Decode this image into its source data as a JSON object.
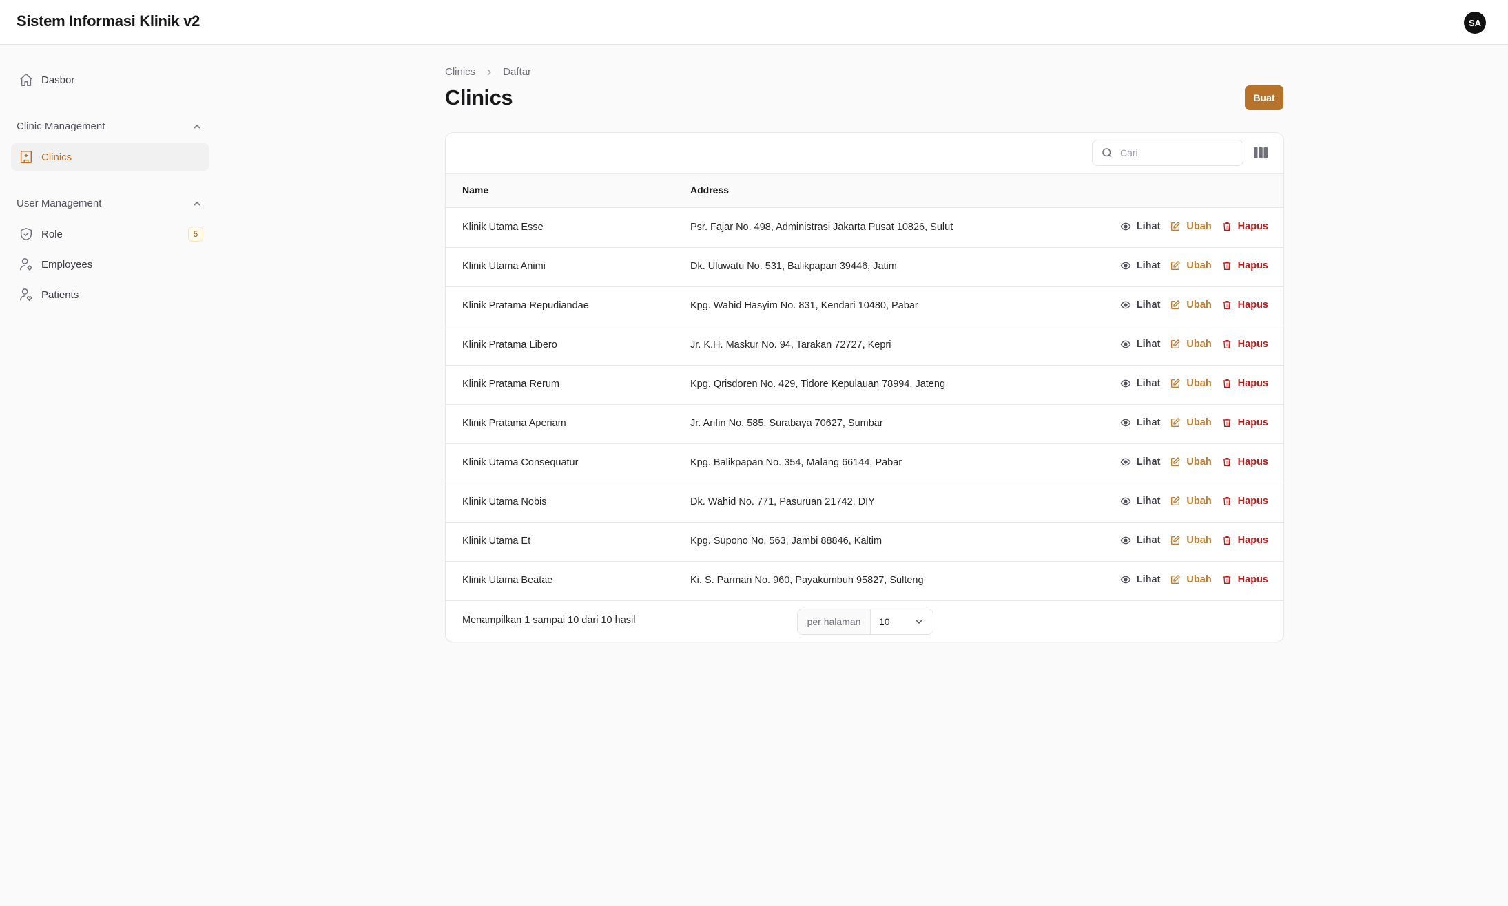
{
  "app": {
    "title": "Sistem Informasi Klinik v2",
    "avatar_initials": "SA"
  },
  "sidebar": {
    "dashboard_label": "Dasbor",
    "groups": [
      {
        "label": "Clinic Management",
        "items": [
          {
            "label": "Clinics",
            "active": true
          }
        ]
      },
      {
        "label": "User Management",
        "items": [
          {
            "label": "Role",
            "badge": "5"
          },
          {
            "label": "Employees"
          },
          {
            "label": "Patients"
          }
        ]
      }
    ]
  },
  "breadcrumb": [
    "Clinics",
    "Daftar"
  ],
  "page": {
    "title": "Clinics",
    "create_label": "Buat"
  },
  "table": {
    "search_placeholder": "Cari",
    "columns": [
      "Name",
      "Address"
    ],
    "action_labels": {
      "view": "Lihat",
      "edit": "Ubah",
      "delete": "Hapus"
    },
    "rows": [
      {
        "name": "Klinik Utama Esse",
        "address": "Psr. Fajar No. 498, Administrasi Jakarta Pusat 10826, Sulut"
      },
      {
        "name": "Klinik Utama Animi",
        "address": "Dk. Uluwatu No. 531, Balikpapan 39446, Jatim"
      },
      {
        "name": "Klinik Pratama Repudiandae",
        "address": "Kpg. Wahid Hasyim No. 831, Kendari 10480, Pabar"
      },
      {
        "name": "Klinik Pratama Libero",
        "address": "Jr. K.H. Maskur No. 94, Tarakan 72727, Kepri"
      },
      {
        "name": "Klinik Pratama Rerum",
        "address": "Kpg. Qrisdoren No. 429, Tidore Kepulauan 78994, Jateng"
      },
      {
        "name": "Klinik Pratama Aperiam",
        "address": "Jr. Arifin No. 585, Surabaya 70627, Sumbar"
      },
      {
        "name": "Klinik Utama Consequatur",
        "address": "Kpg. Balikpapan No. 354, Malang 66144, Pabar"
      },
      {
        "name": "Klinik Utama Nobis",
        "address": "Dk. Wahid No. 771, Pasuruan 21742, DIY"
      },
      {
        "name": "Klinik Utama Et",
        "address": "Kpg. Supono No. 563, Jambi 88846, Kaltim"
      },
      {
        "name": "Klinik Utama Beatae",
        "address": "Ki. S. Parman No. 960, Payakumbuh 95827, Sulteng"
      }
    ],
    "footer": {
      "summary": "Menampilkan 1 sampai 10 dari 10 hasil",
      "per_page_label": "per halaman",
      "per_page_value": "10"
    }
  },
  "colors": {
    "accent": "#b8732a",
    "danger": "#b91c1c"
  }
}
